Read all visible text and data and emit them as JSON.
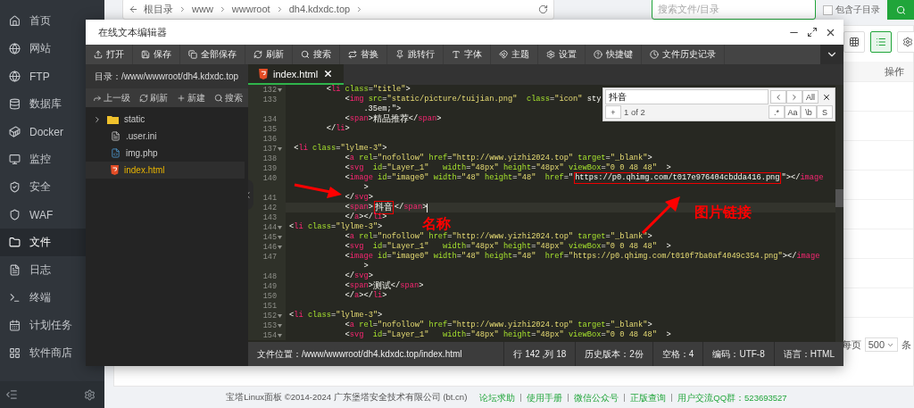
{
  "sidebar": {
    "items": [
      {
        "label": "首页",
        "selected": false
      },
      {
        "label": "网站",
        "selected": false
      },
      {
        "label": "FTP",
        "selected": false
      },
      {
        "label": "数据库",
        "selected": false
      },
      {
        "label": "Docker",
        "selected": false
      },
      {
        "label": "监控",
        "selected": false
      },
      {
        "label": "安全",
        "selected": false
      },
      {
        "label": "WAF",
        "selected": false
      },
      {
        "label": "文件",
        "selected": true
      },
      {
        "label": "日志",
        "selected": false
      },
      {
        "label": "终端",
        "selected": false
      },
      {
        "label": "计划任务",
        "selected": false
      },
      {
        "label": "软件商店",
        "selected": false
      }
    ]
  },
  "topbar": {
    "breadcrumb": [
      "根目录",
      "www",
      "wwwroot",
      "dh4.kdxdc.top"
    ],
    "search": {
      "placeholder": "搜索文件/目录"
    },
    "subdir": {
      "label": "包含子目录",
      "checked": false
    }
  },
  "file_panel": {
    "view_modes": [
      {
        "kind": "grid",
        "selected": false
      },
      {
        "kind": "list",
        "selected": true
      }
    ],
    "column_header": "操作",
    "pager": {
      "prefix": "每页",
      "size": "500",
      "suffix": "条"
    }
  },
  "editor_window": {
    "title": "在线文本编辑器",
    "toolbar": [
      "打开",
      "保存",
      "全部保存",
      "刷新",
      "搜索",
      "替换",
      "跳转行",
      "字体",
      "主题",
      "设置",
      "快捷键",
      "文件历史记录"
    ],
    "directory": "目录：/www/wwwroot/dh4.kdxdc.top",
    "tree_actions": [
      "上一级",
      "刷新",
      "新建",
      "搜索"
    ],
    "tree": [
      {
        "kind": "folder",
        "name": "static",
        "expanded": false,
        "selected": false
      },
      {
        "kind": "text",
        "name": ".user.ini",
        "selected": false
      },
      {
        "kind": "php",
        "name": "img.php",
        "selected": false
      },
      {
        "kind": "html",
        "name": "index.html",
        "selected": true
      }
    ],
    "tabs": [
      {
        "name": "index.html",
        "selected": true
      }
    ],
    "lines": [
      {
        "number": "132",
        "fold": true,
        "active": false,
        "code": "        <li class=\"title\">"
      },
      {
        "number": "133",
        "fold": false,
        "active": false,
        "code": "            <img src=\"static/picture/tuijian.png\"  class=\"icon\" sty",
        "wrap": ".35em;\">"
      },
      {
        "number": "134",
        "fold": false,
        "active": false,
        "code": "            <span>精品推荐</span>"
      },
      {
        "number": "135",
        "fold": false,
        "active": false,
        "code": "        </li>"
      },
      {
        "number": "136",
        "fold": false,
        "active": false
      },
      {
        "number": "137",
        "fold": true,
        "active": false,
        "code": " <li class=\"lylme-3\">"
      },
      {
        "number": "138",
        "fold": false,
        "active": false,
        "code": "            <a rel=\"nofollow\" href=\"http://www.yizhi2024.top\" target=\"_blank\">"
      },
      {
        "number": "139",
        "fold": false,
        "active": false,
        "code": "            <svg  id=\"Layer_1\"   width=\"48px\" height=\"48px\" viewBox=\"0 0 48 48\"  >"
      },
      {
        "number": "140",
        "fold": false,
        "active": false,
        "code": "            <image id=\"image0\" width=\"48\" height=\"48\"  href=\"",
        "boxed": "https://p0.qhimg.com/t017e976404cbdda416.png",
        "after": "\"></image",
        "wrap": ">"
      },
      {
        "number": "141",
        "fold": false,
        "active": false,
        "code": "            </svg>"
      },
      {
        "number": "142",
        "fold": false,
        "active": true,
        "code": "            <span>",
        "boxed": "抖音",
        "after": "</span>"
      },
      {
        "number": "143",
        "fold": false,
        "active": false,
        "code": "            </a></li>"
      },
      {
        "number": "144",
        "fold": true,
        "active": false,
        "code": "<li class=\"lylme-3\">"
      },
      {
        "number": "145",
        "fold": true,
        "active": false,
        "code": "            <a rel=\"nofollow\" href=\"http://www.yizhi2024.top\" target=\"_blank\">"
      },
      {
        "number": "146",
        "fold": true,
        "active": false,
        "code": "            <svg  id=\"Layer_1\"   width=\"48px\" height=\"48px\" viewBox=\"0 0 48 48\"  >"
      },
      {
        "number": "147",
        "fold": false,
        "active": false,
        "code": "            <image id=\"image0\" width=\"48\" height=\"48\"  href=\"https://p0.qhimg.com/t010f7ba0af4049c354.png\"></image",
        "wrap": ">"
      },
      {
        "number": "148",
        "fold": false,
        "active": false,
        "code": "            </svg>"
      },
      {
        "number": "149",
        "fold": false,
        "active": false,
        "code": "            <span>测试</span>"
      },
      {
        "number": "150",
        "fold": false,
        "active": false,
        "code": "            </a></li>"
      },
      {
        "number": "151",
        "fold": false,
        "active": false
      },
      {
        "number": "152",
        "fold": true,
        "active": false,
        "code": "<li class=\"lylme-3\">"
      },
      {
        "number": "153",
        "fold": true,
        "active": false,
        "code": "            <a rel=\"nofollow\" href=\"http://www.yizhi2024.top\" target=\"_blank\">"
      },
      {
        "number": "154",
        "fold": true,
        "active": false,
        "code": "            <svg  id=\"Layer_1\"   width=\"48px\" height=\"48px\" viewBox=\"0 0 48 48\"  >"
      }
    ],
    "find": {
      "query": "抖音",
      "all": "All",
      "add": "+",
      "count": "1 of 2",
      "options": [
        ".*",
        "Aa",
        "\\b",
        "S"
      ]
    },
    "annotations": [
      {
        "kind": "name",
        "text": "名称"
      },
      {
        "kind": "link",
        "text": "图片链接"
      }
    ],
    "status": {
      "path": "文件位置：/www/wwwroot/dh4.kdxdc.top/index.html",
      "items": [
        "行 142 ,列 18",
        "历史版本：2份",
        "空格：4",
        "编码：UTF-8",
        "语言：HTML"
      ]
    }
  },
  "footer": {
    "copyright": "宝塔Linux面板 ©2014-2024 广东堡塔安全技术有限公司 (bt.cn)",
    "links": [
      "论坛求助",
      "使用手册",
      "微信公众号",
      "正版查询",
      "用户交流QQ群：523693527"
    ]
  }
}
